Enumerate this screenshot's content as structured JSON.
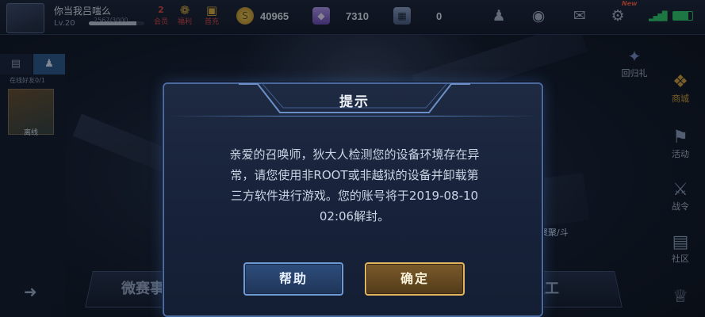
{
  "topbar": {
    "player_name": "你当我吕嗤么",
    "player_level": "Lv.20",
    "exp_text": "2567/3000",
    "exp_fraction": 0.855,
    "vip_label": "会员",
    "vip_level": "2",
    "welfare_label": "福利",
    "first_charge_label": "首充",
    "gold_value": "40965",
    "gem_value": "7310",
    "coupon_value": "0",
    "new_tag": "New"
  },
  "left_panel": {
    "online_friends_label": "在线好友0/1",
    "friend_status": "离线"
  },
  "side_menu": {
    "return_gift": "回归礼",
    "shop": "商城",
    "activity": "活动",
    "battle_pass": "战令",
    "community": "社区"
  },
  "modes": {
    "left_label": "微赛事",
    "right_label": "晶天工",
    "right_badge": "聚聚/斗"
  },
  "dialog": {
    "title": "提示",
    "message_lines": [
      "亲爱的召唤师，狄大人检测您的设备环境存在异",
      "常，请您使用非ROOT或非越狱的设备并卸载第",
      "三方软件进行游戏。您的账号将于2019-08-10",
      "02:06解封。"
    ],
    "help_label": "帮助",
    "ok_label": "确定"
  },
  "colors": {
    "accent_gold": "#e0b460",
    "accent_blue": "#6e9ad4",
    "signal_green": "#2fd06a",
    "vip_red": "#e04747"
  },
  "icons": {
    "gold": "coin-icon",
    "gem": "gem-icon",
    "coupon": "coupon-icon",
    "friends": "friends-icon",
    "eye": "eye-icon",
    "mail": "mail-icon",
    "settings": "gear-icon"
  }
}
